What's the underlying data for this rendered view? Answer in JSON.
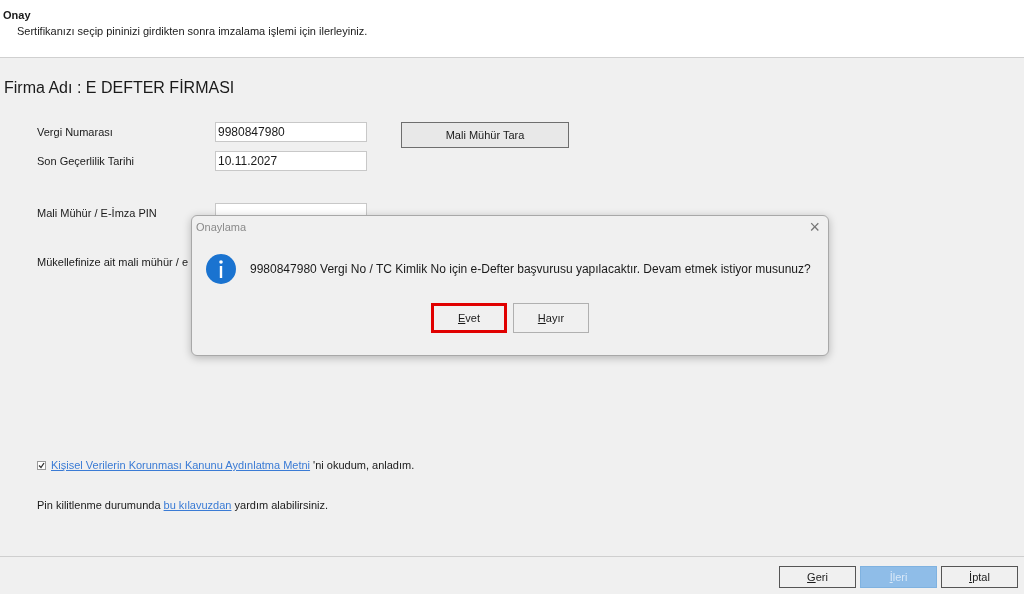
{
  "header": {
    "title": "Onay",
    "subtitle": "Sertifikanızı seçip pininizi girdikten sonra imzalama işlemi için ilerleyiniz."
  },
  "company": "Firma Adı : E DEFTER FİRMASI",
  "fields": [
    {
      "label": "Vergi Numarası",
      "value": "9980847980"
    },
    {
      "label": "Son Geçerlilik Tarihi",
      "value": "10.11.2027"
    }
  ],
  "scan_button": "Mali Mühür Tara",
  "pin_label": "Mali Mühür / E-İmza PIN",
  "cut_label": "Mükellefinize ait mali mühür / e",
  "consent": {
    "checked": true,
    "link": "Kişisel Verilerin Korunması Kanunu Aydınlatma Metni",
    "text": "'ni okudum, anladım."
  },
  "help": {
    "before": "Pin kilitlenme durumunda",
    "link": "bu kılavuzdan",
    "after": "yardım alabilirsiniz."
  },
  "nav_buttons": [
    {
      "label": "Geri",
      "disabled": false
    },
    {
      "label": "İleri",
      "disabled": true
    },
    {
      "label": "İptal",
      "disabled": false
    }
  ],
  "dialog": {
    "title": "Onaylama",
    "close": "×",
    "message": "9980847980 Vergi No / TC Kimlik No için e-Defter başvurusu yapılacaktır. Devam etmek istiyor musunuz?",
    "buttons": [
      {
        "label": "Evet",
        "selected": true
      },
      {
        "label": "Hayır",
        "selected": false
      }
    ]
  }
}
